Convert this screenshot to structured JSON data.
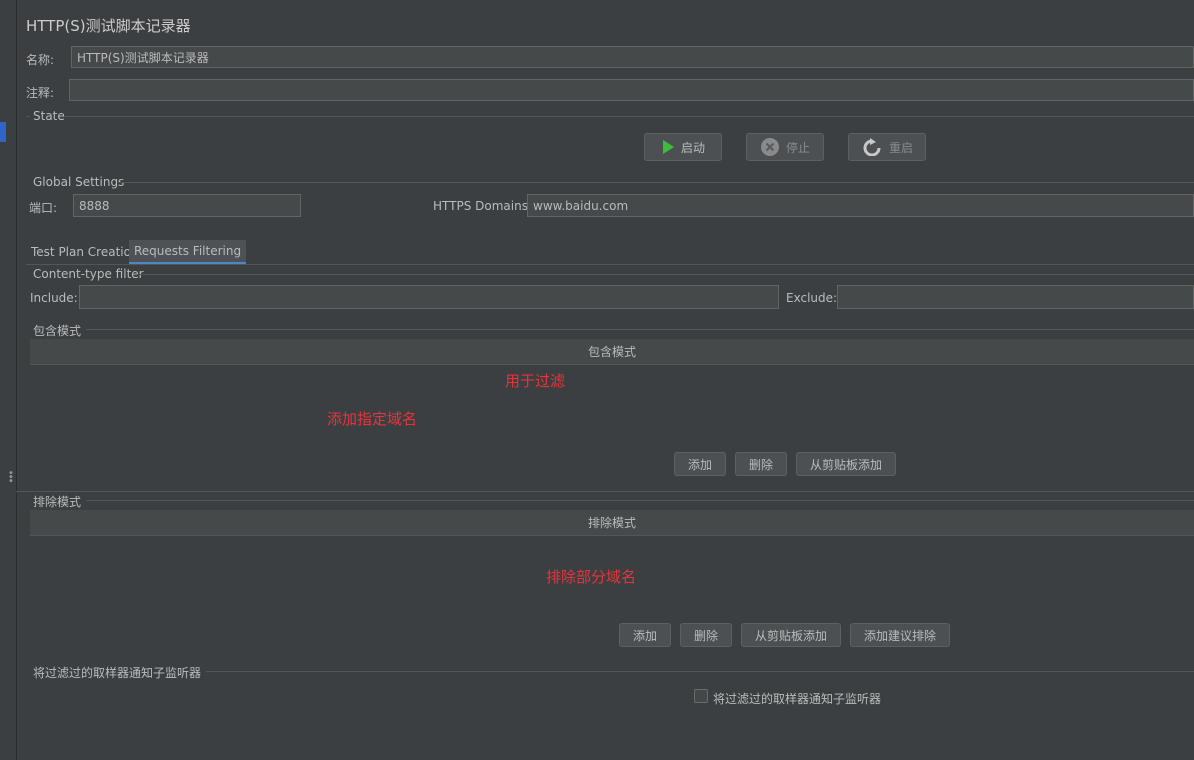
{
  "window": {
    "title": "HTTP(S)测试脚本记录器"
  },
  "name_field": {
    "label": "名称:",
    "value": "HTTP(S)测试脚本记录器"
  },
  "comment_field": {
    "label": "注释:",
    "value": ""
  },
  "state": {
    "title": "State",
    "start_label": "启动",
    "stop_label": "停止",
    "restart_label": "重启"
  },
  "global_settings": {
    "title": "Global Settings",
    "port_label": "端口:",
    "port_value": "8888",
    "https_label": "HTTPS Domains:",
    "https_value": "www.baidu.com"
  },
  "tabs": [
    {
      "label": "Test Plan Creation",
      "active": false
    },
    {
      "label": "Requests Filtering",
      "active": true
    }
  ],
  "content_type_filter": {
    "title": "Content-type filter",
    "include_label": "Include:",
    "include_value": "",
    "exclude_label": "Exclude:",
    "exclude_value": ""
  },
  "include_patterns": {
    "title": "包含模式",
    "column": "包含模式",
    "annotation_1": "用于过滤",
    "annotation_2": "添加指定域名",
    "add_label": "添加",
    "delete_label": "删除",
    "clipboard_label": "从剪贴板添加"
  },
  "exclude_patterns": {
    "title": "排除模式",
    "column": "排除模式",
    "annotation": "排除部分域名",
    "add_label": "添加",
    "delete_label": "删除",
    "clipboard_label": "从剪贴板添加",
    "suggested_label": "添加建议排除"
  },
  "notify": {
    "title": "将过滤过的取样器通知子监听器",
    "checkbox_label": "将过滤过的取样器通知子监听器",
    "checked": false
  },
  "colors": {
    "background": "#3c3f41",
    "annotation": "#e8333b",
    "start_icon": "#3bbf3b",
    "tab_underline": "#4a88c7"
  }
}
